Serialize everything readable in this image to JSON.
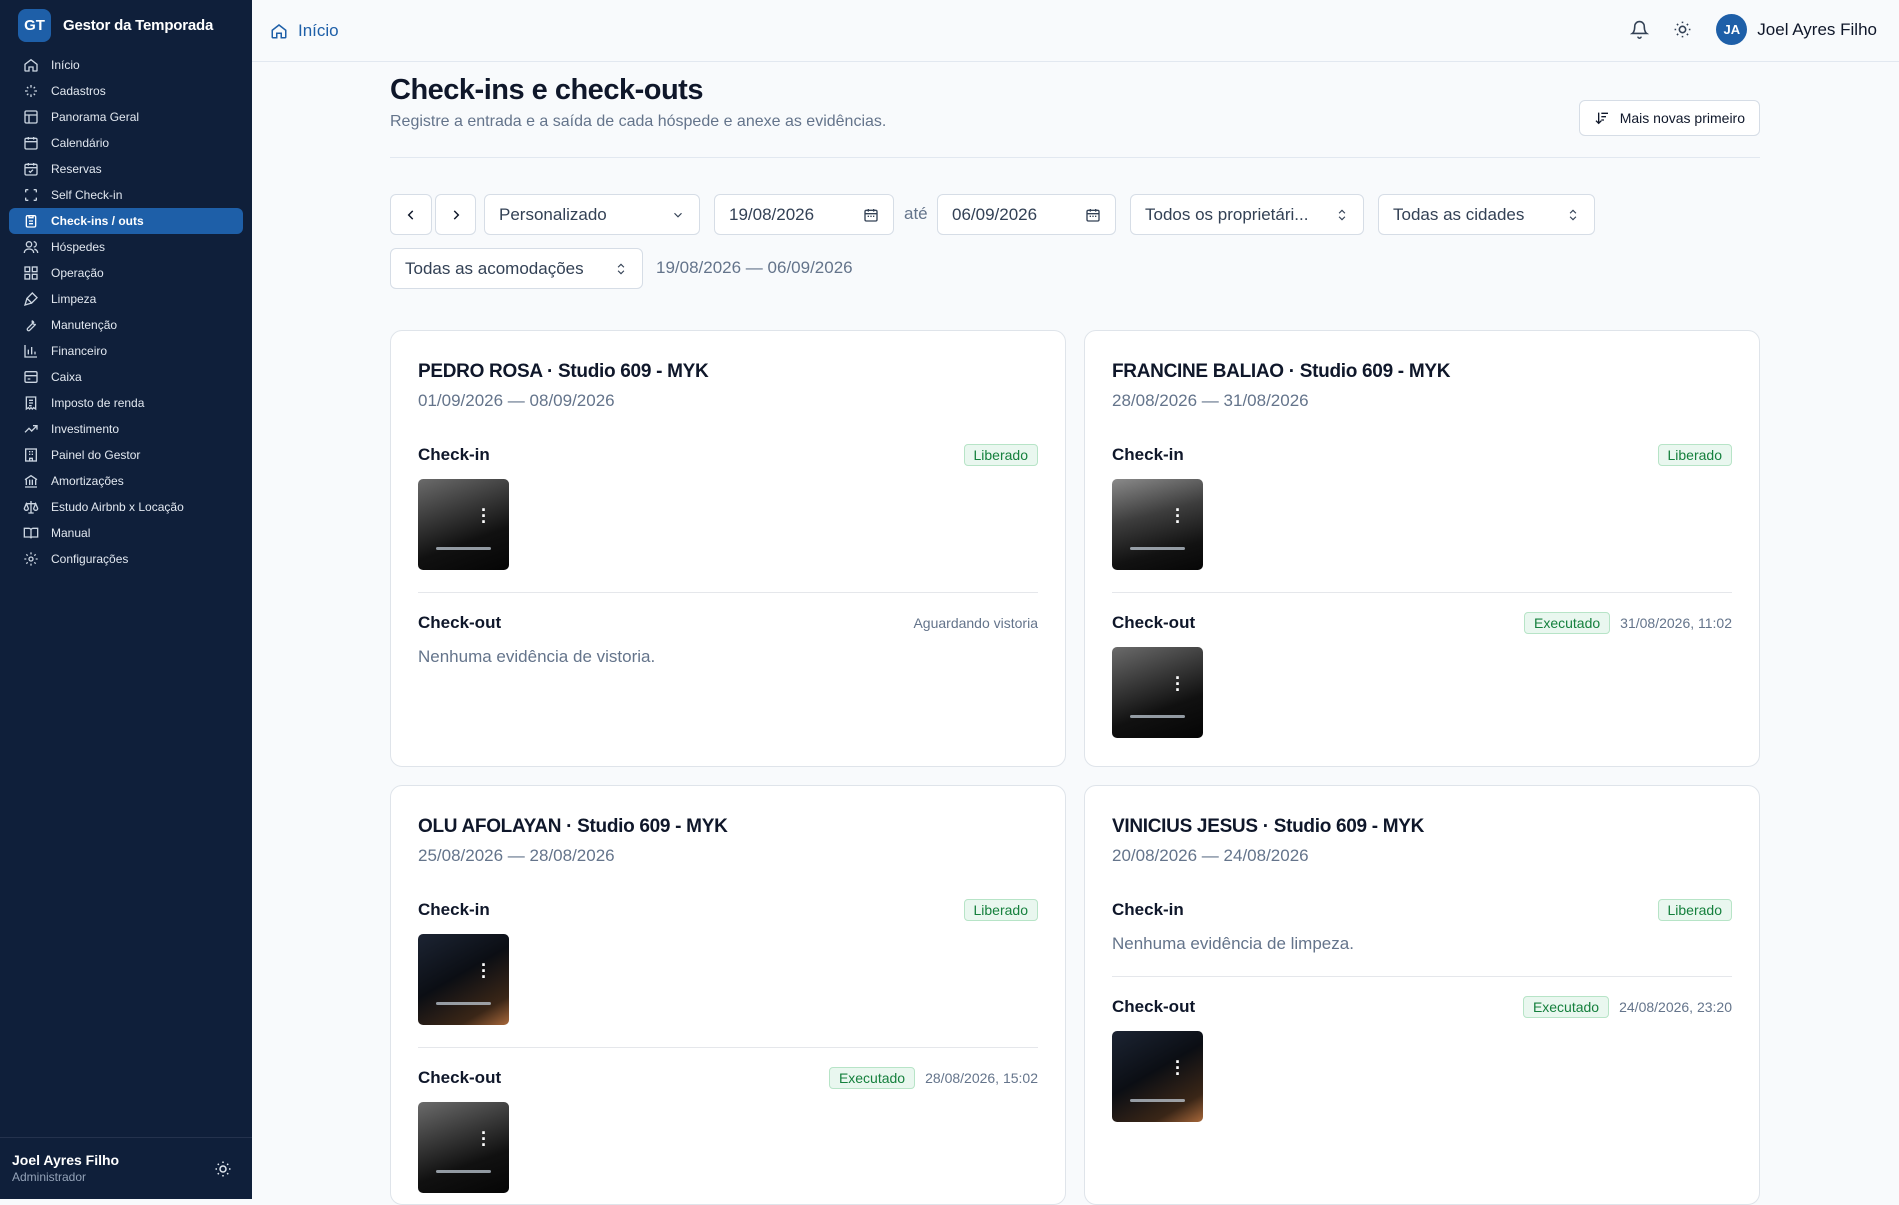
{
  "app": {
    "logo": "GT",
    "name": "Gestor da Temporada"
  },
  "sidebar": {
    "items": [
      {
        "label": "Início",
        "icon": "home-icon"
      },
      {
        "label": "Cadastros",
        "icon": "sparkles-icon"
      },
      {
        "label": "Panorama Geral",
        "icon": "layout-icon"
      },
      {
        "label": "Calendário",
        "icon": "calendar-icon"
      },
      {
        "label": "Reservas",
        "icon": "calendar-check-icon"
      },
      {
        "label": "Self Check-in",
        "icon": "scan-icon"
      },
      {
        "label": "Check-ins / outs",
        "icon": "clipboard-icon",
        "active": true
      },
      {
        "label": "Hóspedes",
        "icon": "users-icon"
      },
      {
        "label": "Operação",
        "icon": "grid-icon"
      },
      {
        "label": "Limpeza",
        "icon": "brush-icon"
      },
      {
        "label": "Manutenção",
        "icon": "wrench-icon"
      },
      {
        "label": "Financeiro",
        "icon": "bar-chart-icon"
      },
      {
        "label": "Caixa",
        "icon": "cash-icon"
      },
      {
        "label": "Imposto de renda",
        "icon": "receipt-icon"
      },
      {
        "label": "Investimento",
        "icon": "trending-up-icon"
      },
      {
        "label": "Painel do Gestor",
        "icon": "building-icon"
      },
      {
        "label": "Amortizações",
        "icon": "bank-icon"
      },
      {
        "label": "Estudo Airbnb x Locação",
        "icon": "scale-icon"
      },
      {
        "label": "Manual",
        "icon": "book-icon"
      },
      {
        "label": "Configurações",
        "icon": "gear-icon"
      }
    ],
    "user": {
      "name": "Joel Ayres Filho",
      "role": "Administrador"
    }
  },
  "topbar": {
    "breadcrumb": "Início",
    "avatar": "JA",
    "user": "Joel Ayres Filho"
  },
  "page": {
    "title": "Check-ins e check-outs",
    "subtitle": "Registre a entrada e a saída de cada hóspede e anexe as evidências.",
    "sort_label": "Mais novas primeiro"
  },
  "filters": {
    "period": "Personalizado",
    "date_from": "19/08/2026",
    "until": "até",
    "date_to": "06/09/2026",
    "owners": "Todos os proprietári...",
    "cities": "Todas as cidades",
    "units": "Todas as acomodações",
    "range": "19/08/2026 — 06/09/2026"
  },
  "cards": [
    {
      "title": "PEDRO ROSA · Studio 609 - MYK",
      "dates": "01/09/2026 — 08/09/2026",
      "checkin": {
        "label": "Check-in",
        "badge": "Liberado"
      },
      "checkout": {
        "label": "Check-out",
        "status": "Aguardando vistoria",
        "empty": "Nenhuma evidência de vistoria."
      }
    },
    {
      "title": "FRANCINE BALIAO · Studio 609 - MYK",
      "dates": "28/08/2026 — 31/08/2026",
      "checkin": {
        "label": "Check-in",
        "badge": "Liberado"
      },
      "checkout": {
        "label": "Check-out",
        "badge": "Executado",
        "time": "31/08/2026, 11:02"
      }
    },
    {
      "title": "OLU AFOLAYAN · Studio 609 - MYK",
      "dates": "25/08/2026 — 28/08/2026",
      "checkin": {
        "label": "Check-in",
        "badge": "Liberado"
      },
      "checkout": {
        "label": "Check-out",
        "badge": "Executado",
        "time": "28/08/2026, 15:02"
      }
    },
    {
      "title": "VINICIUS JESUS · Studio 609 - MYK",
      "dates": "20/08/2026 — 24/08/2026",
      "checkin": {
        "label": "Check-in",
        "badge": "Liberado",
        "empty": "Nenhuma evidência de limpeza."
      },
      "checkout": {
        "label": "Check-out",
        "badge": "Executado",
        "time": "24/08/2026, 23:20"
      }
    }
  ],
  "colors": {
    "sidebar": "#0f1f3a",
    "accent": "#1e5fa8",
    "success": "#15803d"
  }
}
